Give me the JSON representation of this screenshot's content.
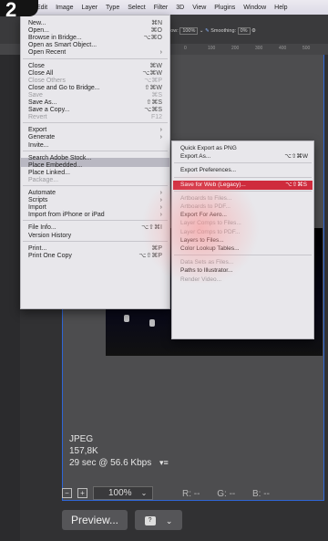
{
  "badge": "2",
  "menubar": {
    "items": [
      "Edit",
      "Image",
      "Layer",
      "Type",
      "Select",
      "Filter",
      "3D",
      "View",
      "Plugins",
      "Window",
      "Help"
    ]
  },
  "options": {
    "zoom_prefix": "low:",
    "zoom": "100%",
    "smoothing_label": "Smoothing:",
    "smoothing_value": "0%",
    "ruler_ticks": [
      "0",
      "100",
      "200",
      "300",
      "400",
      "500"
    ]
  },
  "file_menu": [
    {
      "label": "New...",
      "shortcut": "⌘N",
      "disabled": false
    },
    {
      "label": "Open...",
      "shortcut": "⌘O",
      "disabled": false
    },
    {
      "label": "Browse in Bridge...",
      "shortcut": "⌥⌘O",
      "disabled": false
    },
    {
      "label": "Open as Smart Object...",
      "shortcut": "",
      "disabled": false
    },
    {
      "label": "Open Recent",
      "shortcut": "›",
      "disabled": false
    },
    {
      "sep": true
    },
    {
      "label": "Close",
      "shortcut": "⌘W",
      "disabled": false
    },
    {
      "label": "Close All",
      "shortcut": "⌥⌘W",
      "disabled": false
    },
    {
      "label": "Close Others",
      "shortcut": "⌥⌘P",
      "disabled": true
    },
    {
      "label": "Close and Go to Bridge...",
      "shortcut": "⇧⌘W",
      "disabled": false
    },
    {
      "label": "Save",
      "shortcut": "⌘S",
      "disabled": true
    },
    {
      "label": "Save As...",
      "shortcut": "⇧⌘S",
      "disabled": false
    },
    {
      "label": "Save a Copy...",
      "shortcut": "⌥⌘S",
      "disabled": false
    },
    {
      "label": "Revert",
      "shortcut": "F12",
      "disabled": true
    },
    {
      "sep": true
    },
    {
      "label": "Export",
      "shortcut": "›",
      "disabled": false,
      "highlight": true
    },
    {
      "label": "Generate",
      "shortcut": "›",
      "disabled": false
    },
    {
      "label": "Invite...",
      "shortcut": "",
      "disabled": false
    },
    {
      "sep": true
    },
    {
      "label": "Search Adobe Stock...",
      "shortcut": "",
      "disabled": false
    },
    {
      "label": "Place Embedded...",
      "shortcut": "",
      "disabled": false
    },
    {
      "label": "Place Linked...",
      "shortcut": "",
      "disabled": false
    },
    {
      "label": "Package...",
      "shortcut": "",
      "disabled": true
    },
    {
      "sep": true
    },
    {
      "label": "Automate",
      "shortcut": "›",
      "disabled": false
    },
    {
      "label": "Scripts",
      "shortcut": "›",
      "disabled": false
    },
    {
      "label": "Import",
      "shortcut": "›",
      "disabled": false
    },
    {
      "label": "Import from iPhone or iPad",
      "shortcut": "›",
      "disabled": false
    },
    {
      "sep": true
    },
    {
      "label": "File Info...",
      "shortcut": "⌥⇧⌘I",
      "disabled": false
    },
    {
      "label": "Version History",
      "shortcut": "",
      "disabled": false
    },
    {
      "sep": true
    },
    {
      "label": "Print...",
      "shortcut": "⌘P",
      "disabled": false
    },
    {
      "label": "Print One Copy",
      "shortcut": "⌥⇧⌘P",
      "disabled": false
    }
  ],
  "export_menu": [
    {
      "label": "Quick Export as PNG",
      "shortcut": "",
      "disabled": false
    },
    {
      "label": "Export As...",
      "shortcut": "⌥⇧⌘W",
      "disabled": false
    },
    {
      "sep": true
    },
    {
      "label": "Export Preferences...",
      "shortcut": "",
      "disabled": false
    },
    {
      "sep": true
    },
    {
      "label": "Save for Web (Legacy)...",
      "shortcut": "⌥⇧⌘S",
      "disabled": false,
      "selected": true
    },
    {
      "sep": true
    },
    {
      "label": "Artboards to Files...",
      "shortcut": "",
      "disabled": true
    },
    {
      "label": "Artboards to PDF...",
      "shortcut": "",
      "disabled": true
    },
    {
      "label": "Export For Aero...",
      "shortcut": "",
      "disabled": false
    },
    {
      "label": "Layer Comps to Files...",
      "shortcut": "",
      "disabled": true
    },
    {
      "label": "Layer Comps to PDF...",
      "shortcut": "",
      "disabled": true
    },
    {
      "label": "Layers to Files...",
      "shortcut": "",
      "disabled": false
    },
    {
      "label": "Color Lookup Tables...",
      "shortcut": "",
      "disabled": false
    },
    {
      "sep": true
    },
    {
      "label": "Data Sets as Files...",
      "shortcut": "",
      "disabled": true
    },
    {
      "label": "Paths to Illustrator...",
      "shortcut": "",
      "disabled": false
    },
    {
      "label": "Render Video...",
      "shortcut": "",
      "disabled": true
    }
  ],
  "image_info": {
    "format": "JPEG",
    "size": "157,8K",
    "speed": "29 sec @ 56.6 Kbps",
    "speed_menu": "▾≡"
  },
  "bottom": {
    "zoom": "100%",
    "r": "R: --",
    "g": "G: --",
    "b": "B: --",
    "preview_label": "Preview...",
    "browser_icon_label": "?"
  },
  "colors": {
    "accent_blue": "#2f66d6",
    "selection_red": "#cf2b3d",
    "menu_bg": "#e8e7eb",
    "app_bg": "#2b2b2d"
  }
}
